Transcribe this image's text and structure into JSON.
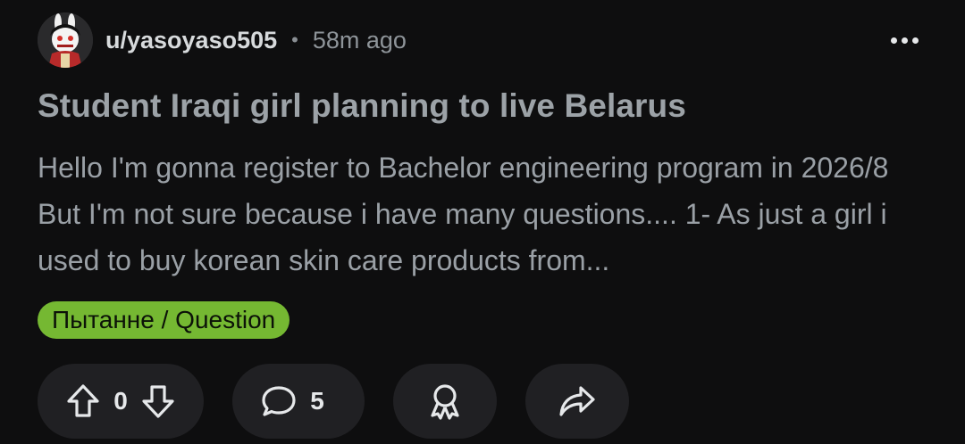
{
  "post": {
    "username": "u/yasoyaso505",
    "separator": "•",
    "timestamp": "58m ago",
    "title": "Student Iraqi girl planning to live Belarus",
    "body": "Hello I'm gonna register to Bachelor engineering program in 2026/8 But I'm not sure because i have many questions.... 1- As just a girl i used to buy korean skin care products from...",
    "flair": "Пытанне / Question"
  },
  "actions": {
    "vote_count": "0",
    "comment_count": "5"
  },
  "icons": {
    "avatar": "user-avatar",
    "more": "more-options-icon",
    "upvote": "upvote-arrow-icon",
    "downvote": "downvote-arrow-icon",
    "comment": "comment-bubble-icon",
    "award": "award-ribbon-icon",
    "share": "share-arrow-icon"
  },
  "colors": {
    "background": "#0e0e0f",
    "flair": "#75b832",
    "button": "#202023",
    "title": "#9ca2a7",
    "body": "#9aa0a6"
  }
}
